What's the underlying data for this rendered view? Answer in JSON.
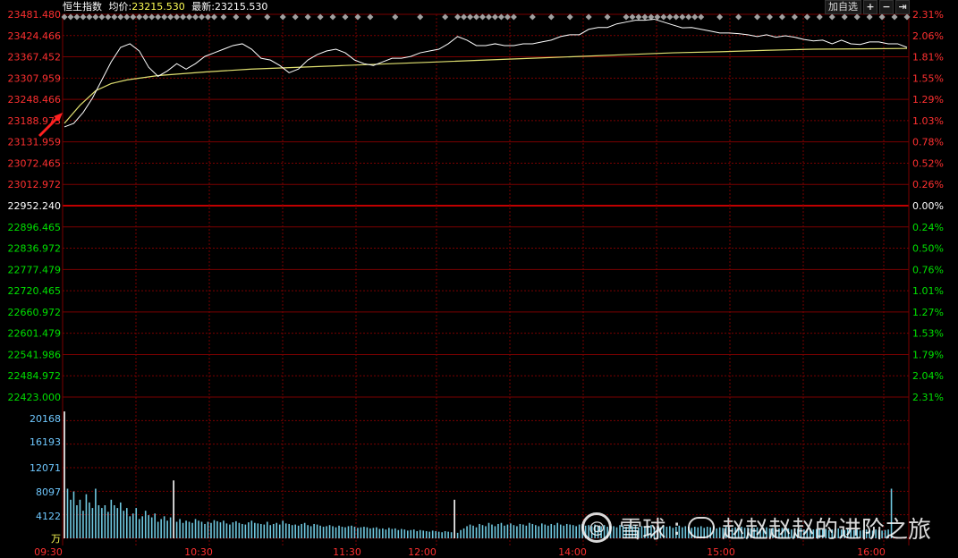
{
  "header": {
    "index_name": "恒生指数",
    "avg_label": "均价:",
    "avg_value": "23215.530",
    "last_label": "最新:",
    "last_value": "23215.530",
    "add_watch_label": "加自选",
    "plus_icon": "plus-icon",
    "minus_icon": "minus-icon",
    "exit_icon": "exit-arrow-icon"
  },
  "colors": {
    "up": "#ff3030",
    "down": "#00e000",
    "neutral": "#ffffff",
    "grid": "#7a0000",
    "price_line": "#ffffff",
    "avg_line": "#e0e070",
    "volume": "#70c8e0",
    "volume_bright": "#ffffff",
    "header_yellow": "#ffff55"
  },
  "watermark": {
    "site": "雪球",
    "sep": ":",
    "author": "赵赵赵赵的进阶之旅"
  },
  "chart_data": {
    "type": "line",
    "title": "恒生指数",
    "prev_close": 22952.24,
    "price_axis": {
      "left_labels": [
        "23481.480",
        "23424.466",
        "23367.452",
        "23307.959",
        "23248.466",
        "23188.973",
        "23131.959",
        "23072.465",
        "23012.972",
        "22952.240",
        "22896.465",
        "22836.972",
        "22777.479",
        "22720.465",
        "22660.972",
        "22601.479",
        "22541.986",
        "22484.972",
        "22423.000"
      ],
      "right_labels": [
        "2.31%",
        "2.06%",
        "1.81%",
        "1.55%",
        "1.29%",
        "1.03%",
        "0.78%",
        "0.52%",
        "0.26%",
        "0.00%",
        "0.24%",
        "0.50%",
        "0.76%",
        "1.01%",
        "1.27%",
        "1.53%",
        "1.79%",
        "2.04%",
        "2.31%"
      ],
      "ylim": [
        22423.0,
        23481.48
      ]
    },
    "volume_axis": {
      "labels": [
        "20168",
        "16193",
        "12071",
        "8097",
        "4122"
      ],
      "unit": "万",
      "ylim": [
        0,
        24000
      ]
    },
    "x_labels": [
      "09:30",
      "10:30",
      "11:30",
      "12:00",
      "14:00",
      "15:00",
      "16:00"
    ],
    "price_series": {
      "name": "",
      "points": [
        [
          0,
          23170
        ],
        [
          3,
          23180
        ],
        [
          6,
          23210
        ],
        [
          9,
          23250
        ],
        [
          12,
          23300
        ],
        [
          15,
          23350
        ],
        [
          18,
          23390
        ],
        [
          21,
          23400
        ],
        [
          24,
          23380
        ],
        [
          27,
          23335
        ],
        [
          30,
          23310
        ],
        [
          33,
          23325
        ],
        [
          36,
          23345
        ],
        [
          39,
          23330
        ],
        [
          42,
          23345
        ],
        [
          45,
          23365
        ],
        [
          48,
          23375
        ],
        [
          51,
          23385
        ],
        [
          54,
          23395
        ],
        [
          57,
          23400
        ],
        [
          60,
          23385
        ],
        [
          63,
          23360
        ],
        [
          66,
          23355
        ],
        [
          69,
          23340
        ],
        [
          72,
          23320
        ],
        [
          75,
          23330
        ],
        [
          78,
          23355
        ],
        [
          81,
          23370
        ],
        [
          84,
          23380
        ],
        [
          87,
          23385
        ],
        [
          90,
          23375
        ],
        [
          93,
          23355
        ],
        [
          96,
          23345
        ],
        [
          99,
          23340
        ],
        [
          102,
          23350
        ],
        [
          105,
          23360
        ],
        [
          108,
          23360
        ],
        [
          111,
          23365
        ],
        [
          114,
          23375
        ],
        [
          117,
          23380
        ],
        [
          120,
          23385
        ],
        [
          123,
          23400
        ],
        [
          126,
          23420
        ],
        [
          129,
          23410
        ],
        [
          132,
          23395
        ],
        [
          135,
          23395
        ],
        [
          138,
          23400
        ],
        [
          141,
          23395
        ],
        [
          144,
          23395
        ],
        [
          147,
          23400
        ],
        [
          150,
          23400
        ],
        [
          153,
          23405
        ],
        [
          156,
          23410
        ],
        [
          159,
          23420
        ],
        [
          162,
          23425
        ],
        [
          165,
          23425
        ],
        [
          168,
          23440
        ],
        [
          171,
          23445
        ],
        [
          174,
          23445
        ],
        [
          177,
          23455
        ],
        [
          180,
          23460
        ],
        [
          183,
          23465
        ],
        [
          186,
          23465
        ],
        [
          189,
          23468
        ],
        [
          192,
          23460
        ],
        [
          195,
          23452
        ],
        [
          198,
          23444
        ],
        [
          201,
          23445
        ],
        [
          204,
          23440
        ],
        [
          207,
          23435
        ],
        [
          210,
          23430
        ],
        [
          213,
          23430
        ],
        [
          216,
          23428
        ],
        [
          219,
          23425
        ],
        [
          222,
          23420
        ],
        [
          225,
          23425
        ],
        [
          228,
          23418
        ],
        [
          231,
          23422
        ],
        [
          234,
          23418
        ],
        [
          237,
          23412
        ],
        [
          240,
          23408
        ],
        [
          243,
          23410
        ],
        [
          246,
          23400
        ],
        [
          249,
          23410
        ],
        [
          252,
          23400
        ],
        [
          255,
          23398
        ],
        [
          258,
          23405
        ],
        [
          261,
          23405
        ],
        [
          264,
          23400
        ],
        [
          267,
          23400
        ],
        [
          270,
          23390
        ]
      ]
    },
    "avg_series": {
      "name": "",
      "points": [
        [
          0,
          23180
        ],
        [
          5,
          23230
        ],
        [
          10,
          23270
        ],
        [
          15,
          23290
        ],
        [
          20,
          23300
        ],
        [
          30,
          23312
        ],
        [
          45,
          23322
        ],
        [
          60,
          23330
        ],
        [
          75,
          23335
        ],
        [
          90,
          23340
        ],
        [
          105,
          23345
        ],
        [
          120,
          23350
        ],
        [
          135,
          23355
        ],
        [
          150,
          23360
        ],
        [
          165,
          23365
        ],
        [
          180,
          23370
        ],
        [
          195,
          23375
        ],
        [
          210,
          23378
        ],
        [
          225,
          23382
        ],
        [
          240,
          23385
        ],
        [
          255,
          23386
        ],
        [
          270,
          23387
        ]
      ]
    },
    "volume_series": {
      "name": "",
      "bright_index": [
        0,
        35,
        125,
        270
      ],
      "values": [
        23000,
        9000,
        7000,
        8500,
        6000,
        7000,
        5000,
        8000,
        6500,
        5500,
        9000,
        6000,
        5500,
        6000,
        4800,
        7000,
        6000,
        5500,
        6500,
        5000,
        5500,
        4000,
        4500,
        5500,
        3500,
        4000,
        5000,
        4200,
        3800,
        4500,
        3000,
        3500,
        4000,
        3200,
        3800,
        10500,
        3000,
        3500,
        2800,
        3200,
        3000,
        2800,
        3500,
        3200,
        3000,
        2600,
        3000,
        2800,
        3300,
        3100,
        2900,
        3200,
        2700,
        2500,
        2900,
        3100,
        2800,
        2600,
        2500,
        2900,
        3200,
        2800,
        2700,
        2600,
        2500,
        3000,
        2400,
        2600,
        2800,
        2500,
        3200,
        2700,
        2600,
        2400,
        2500,
        2300,
        2600,
        2800,
        2400,
        2200,
        2600,
        2500,
        2300,
        2100,
        2200,
        2400,
        2200,
        2000,
        2300,
        2100,
        2000,
        2200,
        2300,
        2100,
        1900,
        2000,
        2100,
        2000,
        1800,
        1900,
        2000,
        1700,
        1800,
        1600,
        1900,
        1700,
        1800,
        1500,
        1700,
        1600,
        1400,
        1500,
        1600,
        1300,
        1500,
        1400,
        1300,
        1200,
        1400,
        1300,
        1200,
        1100,
        1300,
        1200,
        1100,
        7000,
        1000,
        1500,
        1800,
        2200,
        2500,
        2300,
        2000,
        2600,
        2400,
        2200,
        2800,
        2500,
        2200,
        2600,
        2800,
        2300,
        2500,
        2700,
        2400,
        2200,
        2600,
        2500,
        2300,
        2800,
        2600,
        2400,
        2200,
        2700,
        2500,
        2300,
        2600,
        2400,
        2800,
        2500,
        2300,
        2600,
        2500,
        2400,
        2200,
        2500,
        2600,
        2300,
        2400,
        2200,
        2500,
        2300,
        2200,
        2400,
        2100,
        2300,
        2200,
        2000,
        2400,
        2300,
        2100,
        2500,
        2200,
        2300,
        2000,
        2200,
        2100,
        2300,
        2400,
        2100,
        2200,
        2000,
        2300,
        2100,
        2200,
        1900,
        2100,
        2300,
        2000,
        2200,
        2100,
        1900,
        2100,
        2000,
        2200,
        1900,
        2100,
        2000,
        2200,
        1800,
        2000,
        1900,
        2100,
        2000,
        1900,
        2000,
        1800,
        2100,
        1900,
        2000,
        1800,
        1900,
        2000,
        1700,
        1900,
        2000,
        1800,
        1900,
        1700,
        1800,
        1900,
        1700,
        1800,
        1600,
        1800,
        1700,
        1900,
        1600,
        1700,
        1800,
        1600,
        1700,
        1800,
        1600,
        1700,
        1500,
        1600,
        1700,
        1800,
        1600,
        1500,
        1700,
        1600,
        1500,
        1600,
        1400,
        1500,
        1600,
        1500,
        1400,
        1600,
        1500,
        1400,
        1500,
        1600,
        9000
      ]
    },
    "markers": {
      "type": "diamond",
      "slots": [
        0,
        2,
        4,
        6,
        8,
        10,
        12,
        14,
        16,
        18,
        20,
        22,
        24,
        26,
        28,
        30,
        32,
        34,
        36,
        38,
        40,
        42,
        44,
        46,
        48,
        51,
        55,
        59,
        65,
        70,
        74,
        78,
        82,
        86,
        90,
        94,
        98,
        106,
        114,
        122,
        126,
        128,
        130,
        132,
        134,
        136,
        138,
        140,
        142,
        144,
        150,
        156,
        162,
        168,
        174,
        180,
        182,
        184,
        186,
        188,
        190,
        192,
        194,
        196,
        198,
        200,
        202,
        204,
        210,
        216,
        222,
        226,
        230,
        234,
        238,
        242,
        246,
        250,
        254,
        258,
        262,
        266,
        270
      ]
    },
    "grid": true,
    "legend": "none"
  }
}
